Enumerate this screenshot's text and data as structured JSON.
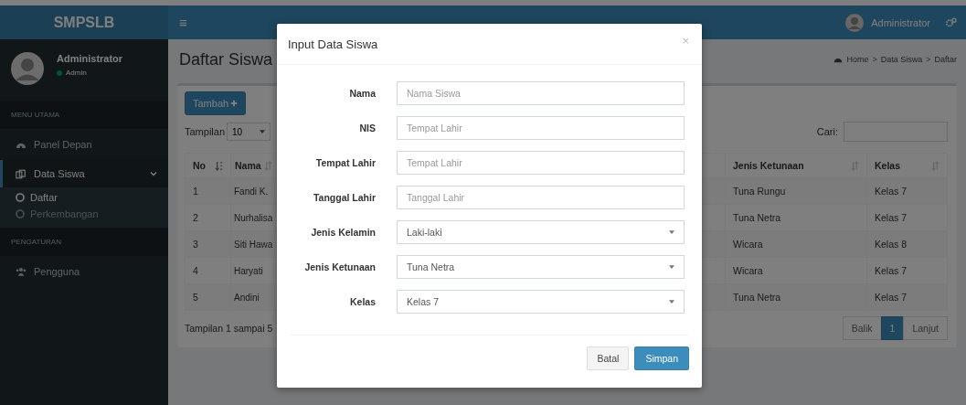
{
  "header": {
    "brand": "SMPSLB",
    "menu_toggle": "≡",
    "user": "Administrator"
  },
  "sidebar": {
    "user": {
      "name": "Administrator",
      "status": "Admin"
    },
    "sections": [
      {
        "title": "MENU UTAMA",
        "items": [
          {
            "label": "Panel Depan",
            "selected": false
          },
          {
            "label": "Data Siswa",
            "selected": true,
            "expanded": true,
            "children": [
              {
                "label": "Daftar",
                "selected": true
              },
              {
                "label": "Perkembangan",
                "selected": false
              }
            ]
          }
        ]
      },
      {
        "title": "PENGATURAN",
        "items": [
          {
            "label": "Pengguna",
            "selected": false
          }
        ]
      }
    ]
  },
  "content": {
    "title": "Daftar Siswa",
    "breadcrumb": [
      "Home",
      "Data Siswa",
      "Daftar"
    ],
    "breadcrumb_separator": ">",
    "add_button": "Tambah",
    "length_label": "Tampilan",
    "length_value": "10",
    "search_label": "Cari:",
    "table": {
      "columns": [
        {
          "label": "No",
          "sorted": true
        },
        {
          "label": "Nama"
        },
        {},
        {
          "label": "Jenis Ketunaan",
          "sorted": false
        },
        {
          "label": "Kelas",
          "sorted": false
        }
      ],
      "rows": [
        {
          "no": "1",
          "nama": "Fandi K.",
          "jenis_ketunaan": "Tuna Rungu",
          "kelas": "Kelas 7"
        },
        {
          "no": "2",
          "nama": "Nurhalisa",
          "jenis_ketunaan": "Tuna Netra",
          "kelas": "Kelas 7"
        },
        {
          "no": "3",
          "nama": "Siti Hawa",
          "jenis_ketunaan": "Wicara",
          "kelas": "Kelas 8"
        },
        {
          "no": "4",
          "nama": "Haryati",
          "jenis_ketunaan": "Wicara",
          "kelas": "Kelas 7"
        },
        {
          "no": "5",
          "nama": "Andini",
          "jenis_ketunaan": "Tuna Netra",
          "kelas": "Kelas 7"
        }
      ]
    },
    "info": "Tampilan 1 sampai 5",
    "pagination": [
      {
        "label": "Balik",
        "selected": false
      },
      {
        "label": "1",
        "selected": true
      },
      {
        "label": "Lanjut",
        "selected": false
      }
    ]
  },
  "modal": {
    "title": "Input Data Siswa",
    "close": "×",
    "fields": [
      {
        "label": "Nama",
        "kind": "text",
        "placeholder": "Nama Siswa"
      },
      {
        "label": "NIS",
        "kind": "text",
        "placeholder": "Tempat Lahir"
      },
      {
        "label": "Tempat Lahir",
        "kind": "text",
        "placeholder": "Tempat Lahir"
      },
      {
        "label": "Tanggal Lahir",
        "kind": "text",
        "placeholder": "Tanggal Lahir"
      },
      {
        "label": "Jenis Kelamin",
        "kind": "select",
        "value": "Laki-laki"
      },
      {
        "label": "Jenis Ketunaan",
        "kind": "select",
        "value": "Tuna Netra"
      },
      {
        "label": "Kelas",
        "kind": "select",
        "value": "Kelas 7"
      }
    ],
    "buttons": [
      {
        "label": "Batal",
        "kind": "default"
      },
      {
        "label": "Simpan",
        "kind": "primary"
      }
    ]
  }
}
